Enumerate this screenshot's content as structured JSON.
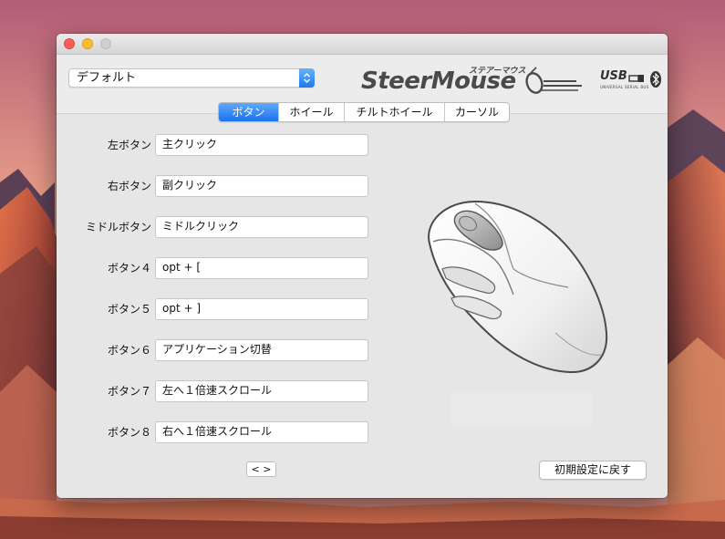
{
  "profile": {
    "selected": "デフォルト"
  },
  "logo": {
    "name": "SteerMouse",
    "subtitle": "ステアーマウス"
  },
  "badges": {
    "usb": "USB",
    "usb_subtitle": "UNIVERSAL SERIAL BUS"
  },
  "tabs": [
    {
      "label": "ボタン",
      "active": true
    },
    {
      "label": "ホイール",
      "active": false
    },
    {
      "label": "チルトホイール",
      "active": false
    },
    {
      "label": "カーソル",
      "active": false
    }
  ],
  "buttons": [
    {
      "label": "左ボタン",
      "value": "主クリック"
    },
    {
      "label": "右ボタン",
      "value": "副クリック"
    },
    {
      "label": "ミドルボタン",
      "value": "ミドルクリック"
    },
    {
      "label": "ボタン４",
      "value": "opt + ["
    },
    {
      "label": "ボタン５",
      "value": "opt + ]"
    },
    {
      "label": "ボタン６",
      "value": "アプリケーション切替"
    },
    {
      "label": "ボタン７",
      "value": "左へ１倍速スクロール"
    },
    {
      "label": "ボタン８",
      "value": "右へ１倍速スクロール"
    }
  ],
  "footer": {
    "nav_label": "< >",
    "reset_label": "初期設定に戻す"
  },
  "colors": {
    "accent": "#1a72ec",
    "close": "#fc5f57",
    "minimize": "#fdbc2e",
    "zoom": "#cfcfcf"
  },
  "icons": {
    "bluetooth": "bluetooth-icon",
    "usb": "usb-plug-icon",
    "select": "chevron-updown-icon"
  }
}
